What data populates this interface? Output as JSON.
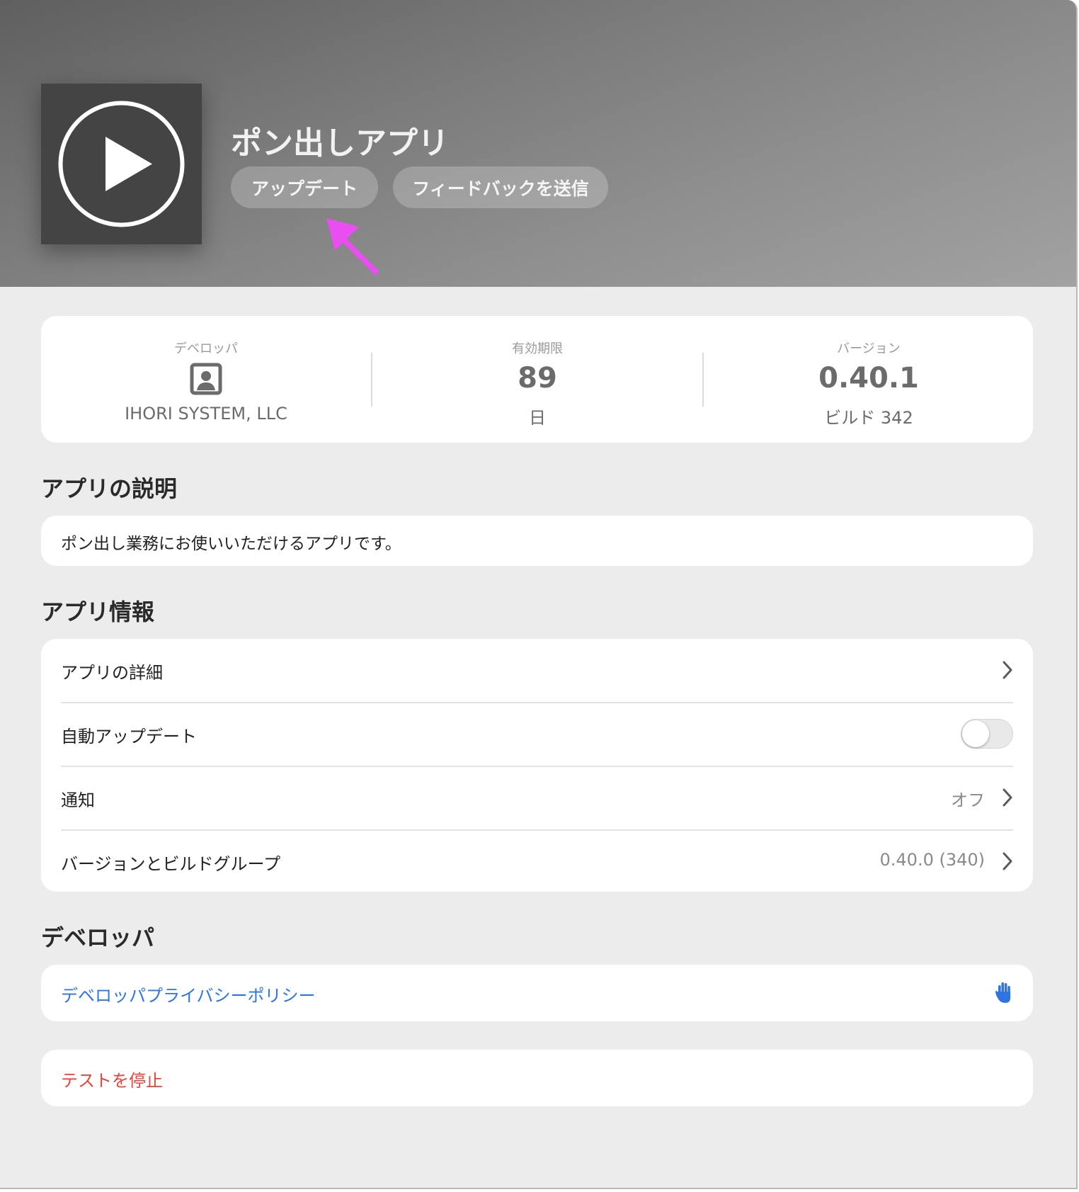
{
  "app": {
    "name": "ポン出しアプリ",
    "update_label": "アップデート",
    "feedback_label": "フィードバックを送信"
  },
  "stats": {
    "developer": {
      "label": "デベロッパ",
      "name": "IHORI SYSTEM, LLC"
    },
    "expiry": {
      "label": "有効期限",
      "value": "89",
      "unit": "日"
    },
    "version": {
      "label": "バージョン",
      "value": "0.40.1",
      "build": "ビルド 342"
    }
  },
  "description": {
    "title": "アプリの説明",
    "text": "ポン出し業務にお使いいただけるアプリです。"
  },
  "info": {
    "title": "アプリ情報",
    "rows": [
      {
        "label": "アプリの詳細",
        "value": ""
      },
      {
        "label": "自動アップデート",
        "value": ""
      },
      {
        "label": "通知",
        "value": "オフ"
      },
      {
        "label": "バージョンとビルドグループ",
        "value": "0.40.0 (340)"
      }
    ],
    "auto_update_on": false
  },
  "developer_section": {
    "title": "デベロッパ",
    "privacy_link": "デベロッパプライバシーポリシー"
  },
  "stop_test_label": "テストを停止",
  "icons": {
    "app_icon": "play-circle-icon",
    "developer": "person-badge-icon",
    "privacy": "hand-raised-icon",
    "annotation": "arrow-pointer-icon"
  },
  "colors": {
    "link_blue": "#2f74e0",
    "danger_red": "#e5463c",
    "annotation_magenta": "#e84ef0"
  }
}
